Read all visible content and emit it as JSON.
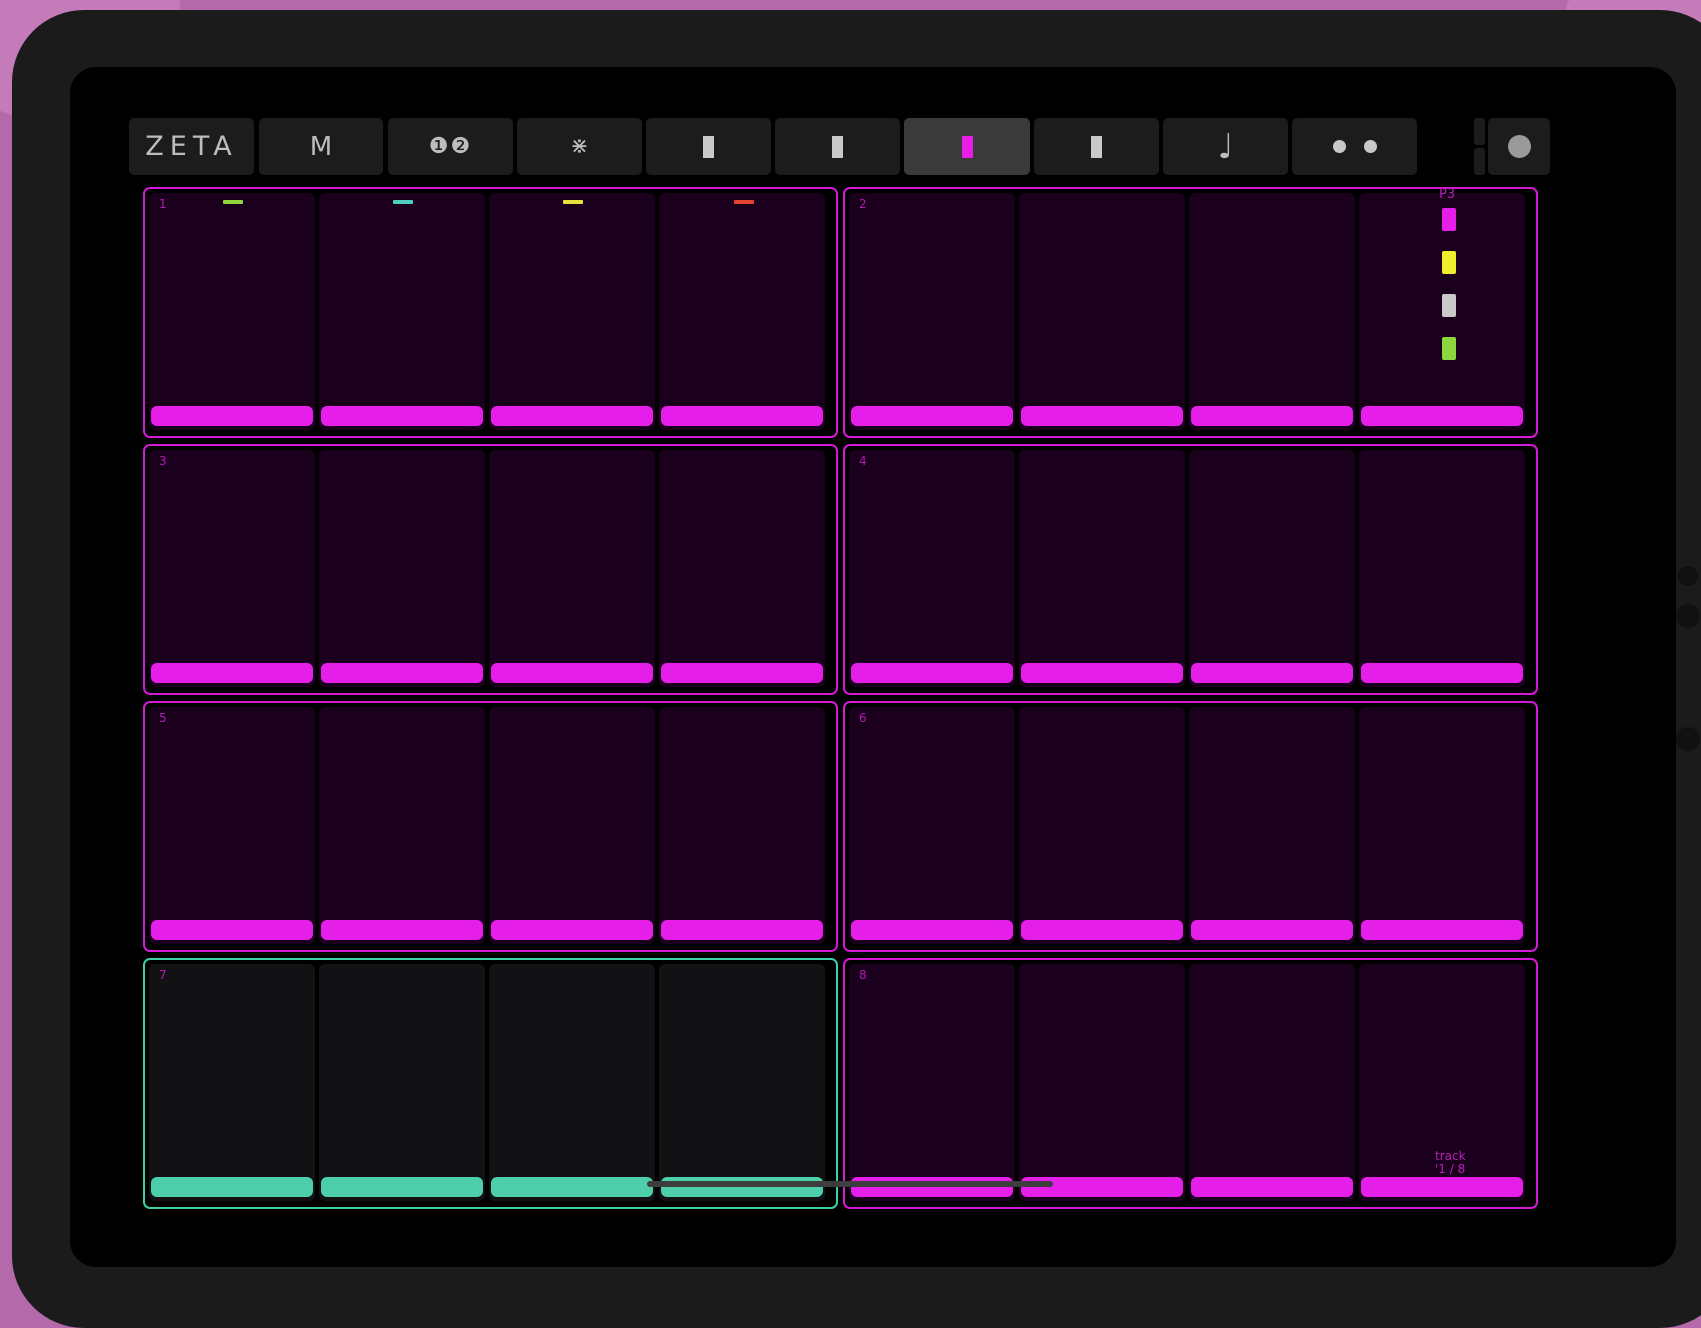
{
  "colors": {
    "accent": "#e51ee9",
    "teal": "#4ecfac",
    "pad_bg": "#1b001e"
  },
  "toolbar": {
    "logo": "ZETA",
    "mode": "M",
    "numbers": "❶❷",
    "asterisk": "⋇",
    "pages": [
      {
        "name": "page-1",
        "active": false
      },
      {
        "name": "page-2",
        "active": false
      },
      {
        "name": "page-3",
        "active": true
      },
      {
        "name": "page-4",
        "active": false
      }
    ],
    "note_icon": "♩",
    "dots_icon": "two-dots-icon",
    "record_icon": "circle-icon"
  },
  "groups": [
    {
      "number": "1",
      "color": "magenta"
    },
    {
      "number": "2",
      "color": "magenta"
    },
    {
      "number": "3",
      "color": "magenta"
    },
    {
      "number": "4",
      "color": "magenta"
    },
    {
      "number": "5",
      "color": "magenta"
    },
    {
      "number": "6",
      "color": "magenta"
    },
    {
      "number": "7",
      "color": "teal"
    },
    {
      "number": "8",
      "color": "magenta"
    }
  ],
  "group1_markers": [
    "#8ed63e",
    "#4fcfc0",
    "#e6e23a",
    "#e2452c"
  ],
  "side": {
    "preset_label": "P3",
    "swatches": [
      "#e51ee9",
      "#f0ee2c",
      "#c9c9c9",
      "#8ed63e"
    ],
    "track_label": "track",
    "track_value": "'1 / 8"
  }
}
